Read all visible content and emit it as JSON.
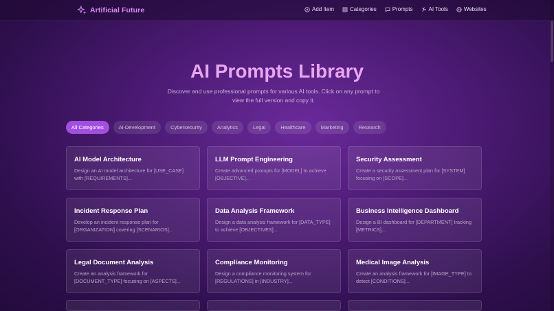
{
  "brand": {
    "name": "Artificial Future",
    "icon": "sparkles-icon",
    "color": "#d58df0"
  },
  "nav": [
    {
      "label": "Add Item",
      "icon": "plus-circle-icon"
    },
    {
      "label": "Categories",
      "icon": "grid-icon"
    },
    {
      "label": "Prompts",
      "icon": "chat-icon"
    },
    {
      "label": "AI Tools",
      "icon": "tools-icon"
    },
    {
      "label": "Websites",
      "icon": "globe-icon"
    }
  ],
  "hero": {
    "title": "AI Prompts Library",
    "subtitle": "Discover and use professional prompts for various AI tools. Click on any prompt to view the full version and copy it."
  },
  "filters": [
    {
      "label": "All Categories",
      "active": true
    },
    {
      "label": "Ai-Development"
    },
    {
      "label": "Cybersecurity"
    },
    {
      "label": "Analytics"
    },
    {
      "label": "Legal"
    },
    {
      "label": "Healthcare"
    },
    {
      "label": "Marketing"
    },
    {
      "label": "Research"
    }
  ],
  "cards": [
    {
      "title": "AI Model Architecture",
      "desc": "Design an AI model architecture for [USE_CASE] with [REQUIREMENTS]..."
    },
    {
      "title": "LLM Prompt Engineering",
      "desc": "Create advanced prompts for [MODEL] to achieve [OBJECTIVE]..."
    },
    {
      "title": "Security Assessment",
      "desc": "Create a security assessment plan for [SYSTEM] focusing on [SCOPE]..."
    },
    {
      "title": "Incident Response Plan",
      "desc": "Develop an incident response plan for [ORGANIZATION] covering [SCENARIOS]..."
    },
    {
      "title": "Data Analysis Framework",
      "desc": "Design a data analysis framework for [DATA_TYPE] to achieve [OBJECTIVES]..."
    },
    {
      "title": "Business Intelligence Dashboard",
      "desc": "Design a BI dashboard for [DEPARTMENT] tracking [METRICS]..."
    },
    {
      "title": "Legal Document Analysis",
      "desc": "Create an analysis framework for [DOCUMENT_TYPE] focusing on [ASPECTS]..."
    },
    {
      "title": "Compliance Monitoring",
      "desc": "Design a compliance monitoring system for [REGULATIONS] in [INDUSTRY]..."
    },
    {
      "title": "Medical Image Analysis",
      "desc": "Create an analysis framework for [IMAGE_TYPE] to detect [CONDITIONS]..."
    }
  ],
  "colors": {
    "accent": "#a24fe0",
    "title": "#e9a6ef"
  }
}
